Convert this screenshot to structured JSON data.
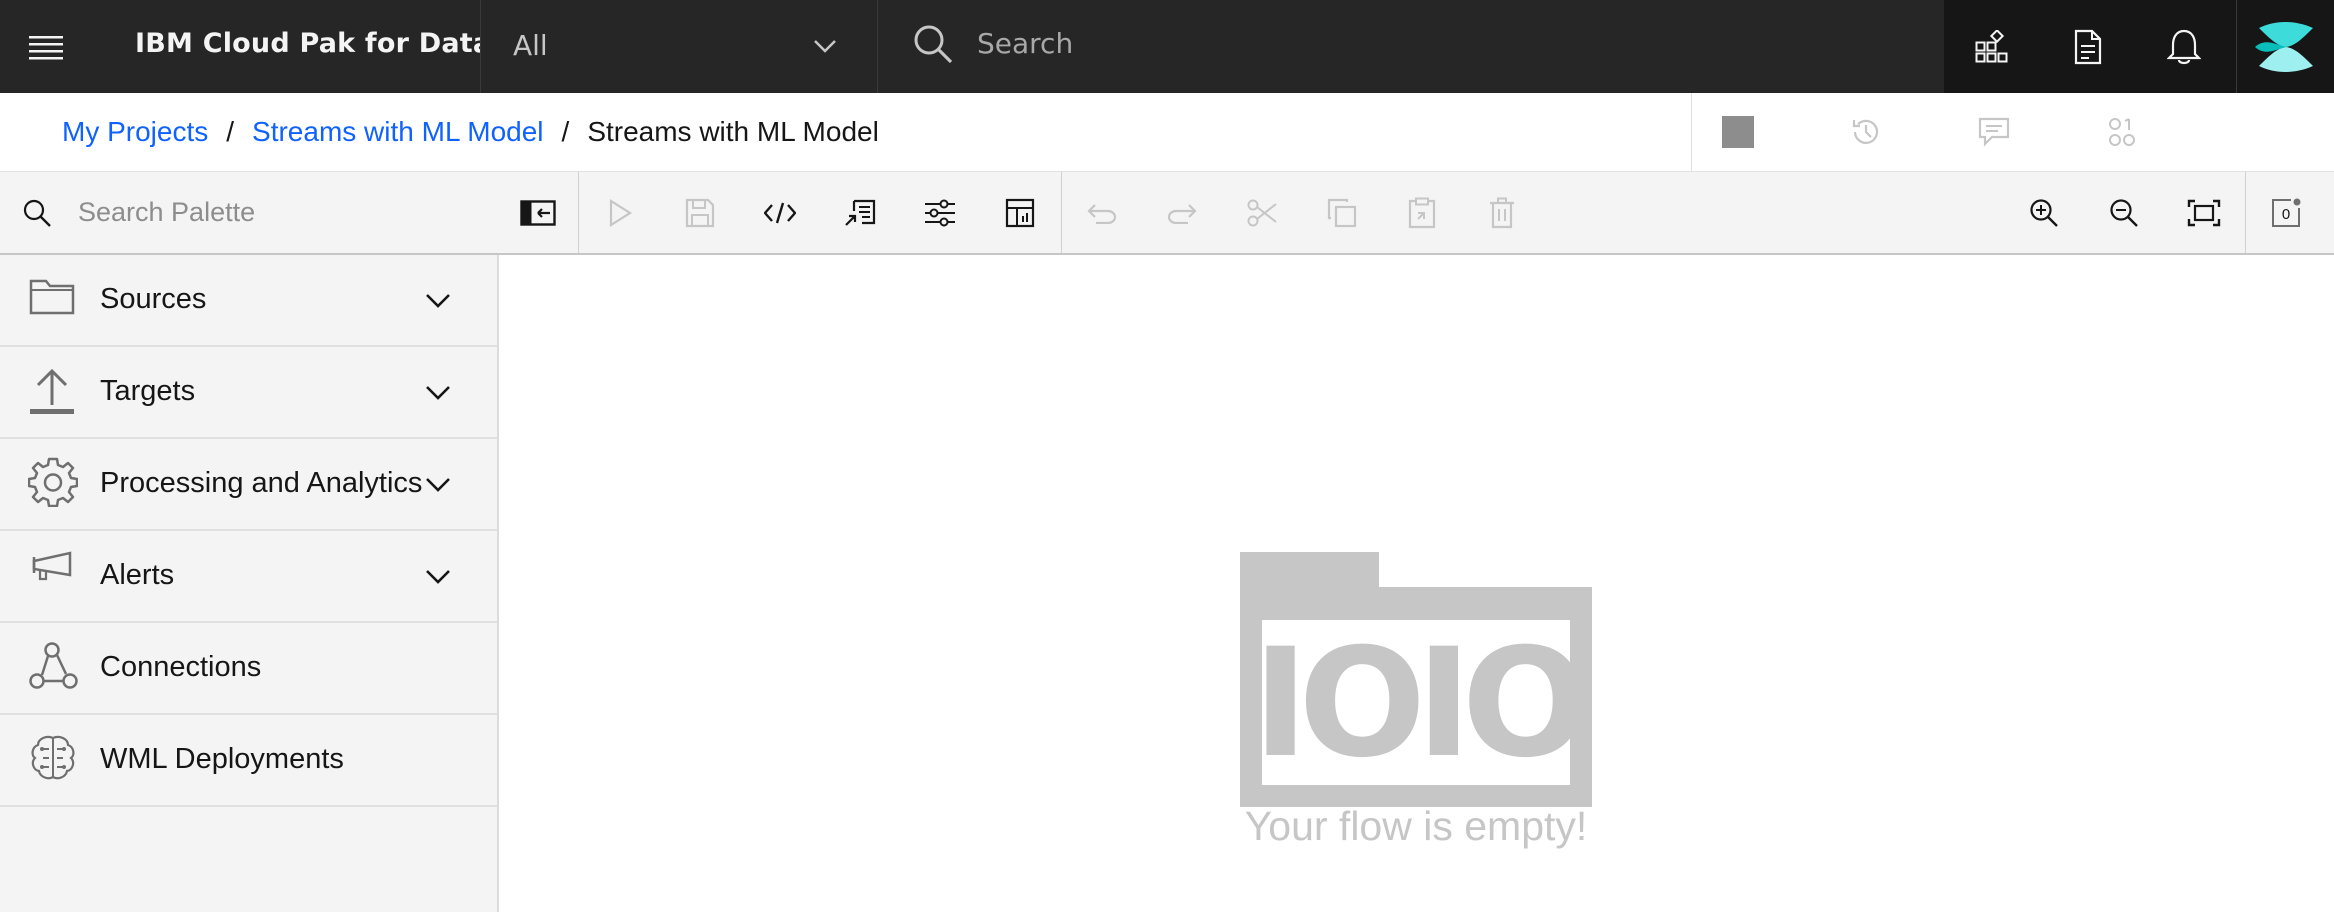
{
  "header": {
    "product_name": "IBM Cloud Pak for Data",
    "scope_value": "All",
    "search_placeholder": "Search",
    "icons": [
      "switcher-icon",
      "document-icon",
      "notification-icon"
    ],
    "avatar": "avatar-icon"
  },
  "breadcrumb": {
    "items": [
      {
        "label": "My Projects"
      },
      {
        "label": "Streams with ML Model"
      }
    ],
    "separator": "/",
    "current": "Streams with ML Model",
    "actions": [
      "stop-icon",
      "history-icon",
      "comment-icon",
      "metrics-icon"
    ]
  },
  "toolbar": {
    "palette_placeholder": "Search Palette",
    "notification_count": "0",
    "buttons": [
      "collapse-palette-icon",
      "run-icon",
      "save-icon",
      "code-icon",
      "export-icon",
      "settings-icon",
      "metrics-panel-icon",
      "undo-icon",
      "redo-icon",
      "cut-icon",
      "copy-icon",
      "paste-icon",
      "delete-icon",
      "zoom-in-icon",
      "zoom-out-icon",
      "fit-to-screen-icon"
    ]
  },
  "palette": {
    "categories": [
      {
        "label": "Sources",
        "icon": "folder-icon",
        "expandable": true
      },
      {
        "label": "Targets",
        "icon": "upload-icon",
        "expandable": true
      },
      {
        "label": "Processing and Analytics",
        "icon": "gear-icon",
        "expandable": true
      },
      {
        "label": "Alerts",
        "icon": "megaphone-icon",
        "expandable": true
      },
      {
        "label": "Connections",
        "icon": "connections-icon",
        "expandable": false
      },
      {
        "label": "WML Deployments",
        "icon": "brain-icon",
        "expandable": false
      }
    ]
  },
  "canvas": {
    "empty_graphic_text": "IOIO",
    "empty_message": "Your flow is empty!"
  },
  "colors": {
    "header_bg": "#262626",
    "link": "#0f62fe",
    "panel_bg": "#f4f4f4",
    "empty_gray": "#c6c6c6"
  }
}
